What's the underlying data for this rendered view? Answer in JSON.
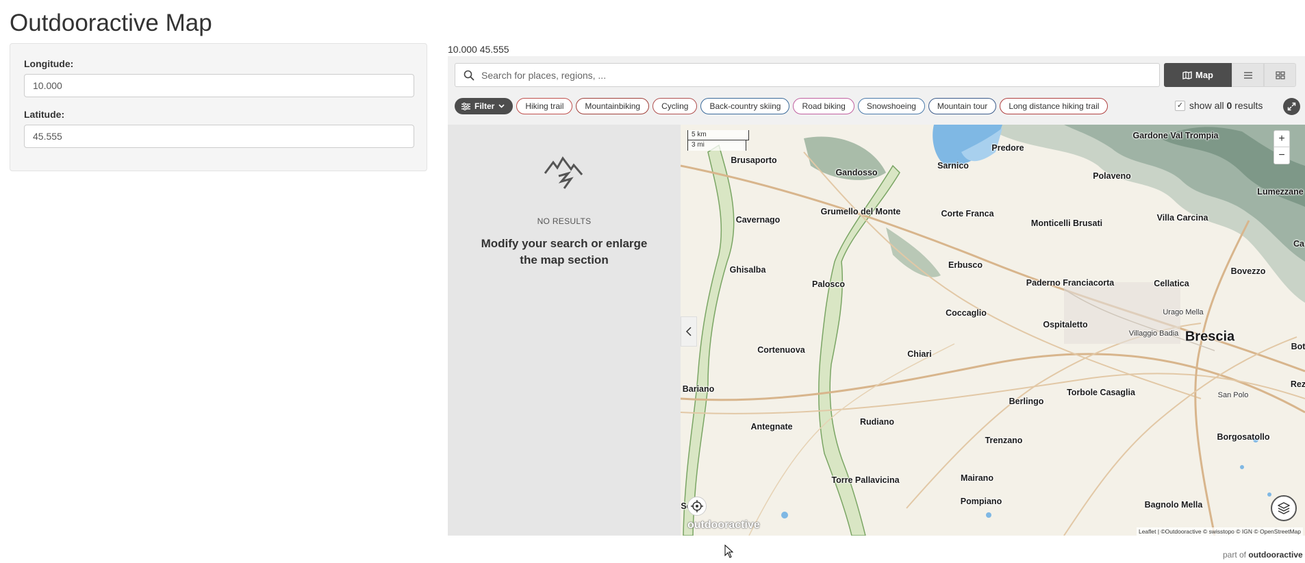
{
  "page": {
    "title": "Outdooractive Map"
  },
  "form": {
    "longitude": {
      "label": "Longitude:",
      "value": "10.000"
    },
    "latitude": {
      "label": "Latitude:",
      "value": "45.555"
    }
  },
  "coord_output": "10.000 45.555",
  "widget": {
    "search": {
      "placeholder": "Search for places, regions, ..."
    },
    "view_tabs": {
      "map": "Map"
    },
    "filter": {
      "label": "Filter"
    },
    "categories": [
      {
        "label": "Hiking trail",
        "color": "#c0504d"
      },
      {
        "label": "Mountainbiking",
        "color": "#a0403a"
      },
      {
        "label": "Cycling",
        "color": "#b05050"
      },
      {
        "label": "Back-country skiing",
        "color": "#3a6a9a"
      },
      {
        "label": "Road biking",
        "color": "#c060a0"
      },
      {
        "label": "Snowshoeing",
        "color": "#4a7aaa"
      },
      {
        "label": "Mountain tour",
        "color": "#3a5a8a"
      },
      {
        "label": "Long distance hiking trail",
        "color": "#b04040"
      }
    ],
    "show_all": {
      "prefix": "show all ",
      "count": "0",
      "suffix": " results",
      "checked": true
    },
    "no_results": {
      "label": "NO RESULTS",
      "message": "Modify your search or enlarge the map section"
    }
  },
  "map": {
    "scale": {
      "km": "5 km",
      "mi": "3 mi"
    },
    "zoom": {
      "in": "+",
      "out": "−"
    },
    "logo": "outdooractive",
    "attribution": "Leaflet | ©Outdooractive © swisstopo © IGN © OpenStreetMap",
    "places": [
      "Gardone Val Trompia",
      "Predore",
      "Brusaporto",
      "Gandosso",
      "Sarnico",
      "Polaveno",
      "Lumezzane",
      "Cavernago",
      "Grumello del Monte",
      "Corte Franca",
      "Monticelli Brusati",
      "Villa Carcina",
      "Ghisalba",
      "Palosco",
      "Erbusco",
      "Paderno Franciacorta",
      "Cellatica",
      "Bovezzo",
      "Urago Mella",
      "Coccaglio",
      "Ospitaletto",
      "Villaggio Badia",
      "Brescia",
      "Cortenuova",
      "Chiari",
      "Bariano",
      "Torbole Casaglia",
      "Berlingo",
      "San Polo",
      "Antegnate",
      "Rudiano",
      "Borgosatollo",
      "Trenzano",
      "Mairano",
      "Torre Pallavicina",
      "Pompiano",
      "Bagnolo Mella",
      "Se",
      "Ca",
      "Bot",
      "Rez"
    ]
  },
  "footer": {
    "partof_prefix": "part of ",
    "partof_brand": "outdooractive"
  }
}
